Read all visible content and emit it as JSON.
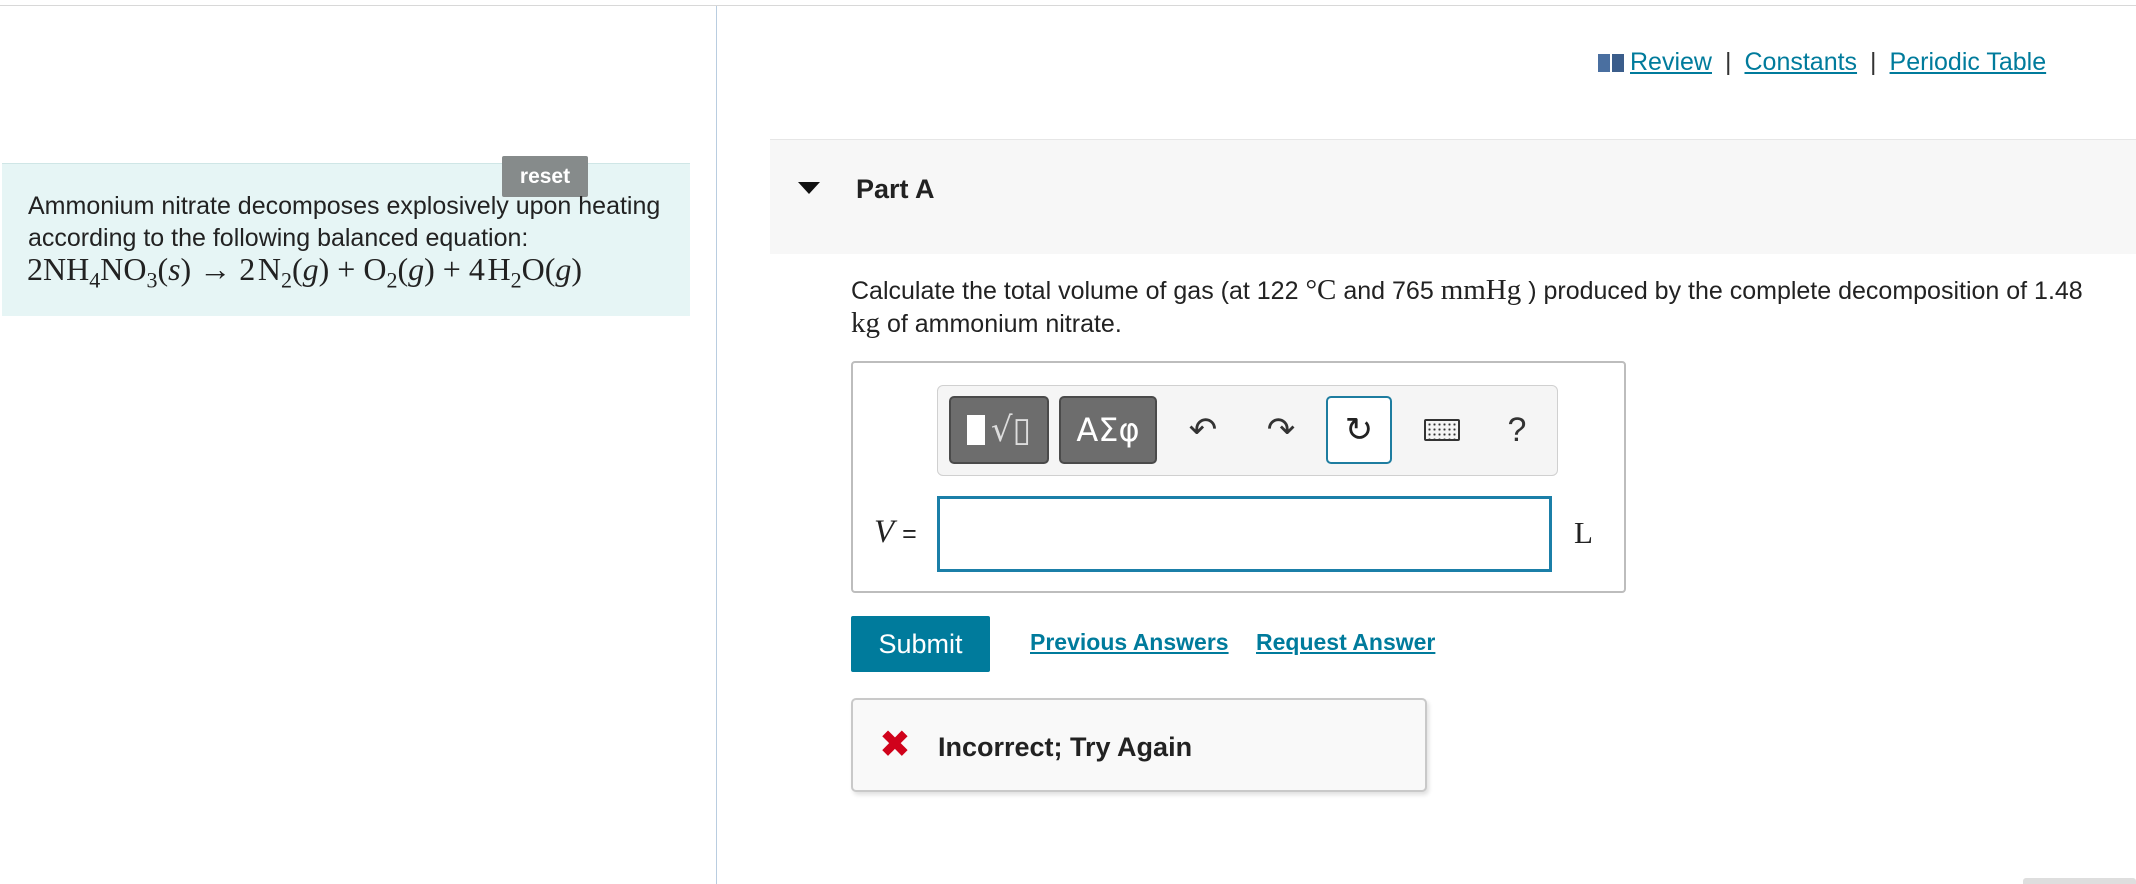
{
  "intro": {
    "reset_label": "reset",
    "text": "Ammonium nitrate decomposes explosively upon heating according to the following balanced equation:",
    "equation": {
      "coef1": "2",
      "reactant": "NH",
      "reactant_sub": "4",
      "reactant2": "NO",
      "reactant2_sub": "3",
      "state_s": "s",
      "arrow": "→",
      "coef2": "2",
      "n2": "N",
      "n2_sub": "2",
      "state_g": "g",
      "plus": "+",
      "o2": "O",
      "o2_sub": "2",
      "coef3": "4",
      "h2o_h": "H",
      "h2o_sub": "2",
      "h2o_o": "O"
    }
  },
  "toplinks": {
    "review": "Review",
    "constants": "Constants",
    "periodic": "Periodic Table",
    "separator": "|"
  },
  "part": {
    "title": "Part A"
  },
  "question": {
    "line1_a": "Calculate the total volume of gas (at 122",
    "degree_unit": "°C",
    "line1_b": "and 765",
    "pressure_unit": "mmHg",
    "line1_c": ") produced by the complete decomposition of 1.48",
    "mass_unit": "kg",
    "line2": "of ammonium nitrate."
  },
  "toolbar": {
    "greek_label": "ΑΣφ",
    "undo_glyph": "↶",
    "redo_glyph": "↷",
    "reset_glyph": "↻",
    "help_label": "?"
  },
  "answer": {
    "variable": "V",
    "equals": "=",
    "value": "",
    "unit": "L"
  },
  "actions": {
    "submit_label": "Submit",
    "previous_answers": "Previous Answers",
    "request_answer": "Request Answer"
  },
  "feedback": {
    "icon": "✖",
    "text": "Incorrect; Try Again"
  },
  "colors": {
    "accent": "#007b9c",
    "error": "#d0021b",
    "intro_bg": "#e6f5f5"
  }
}
